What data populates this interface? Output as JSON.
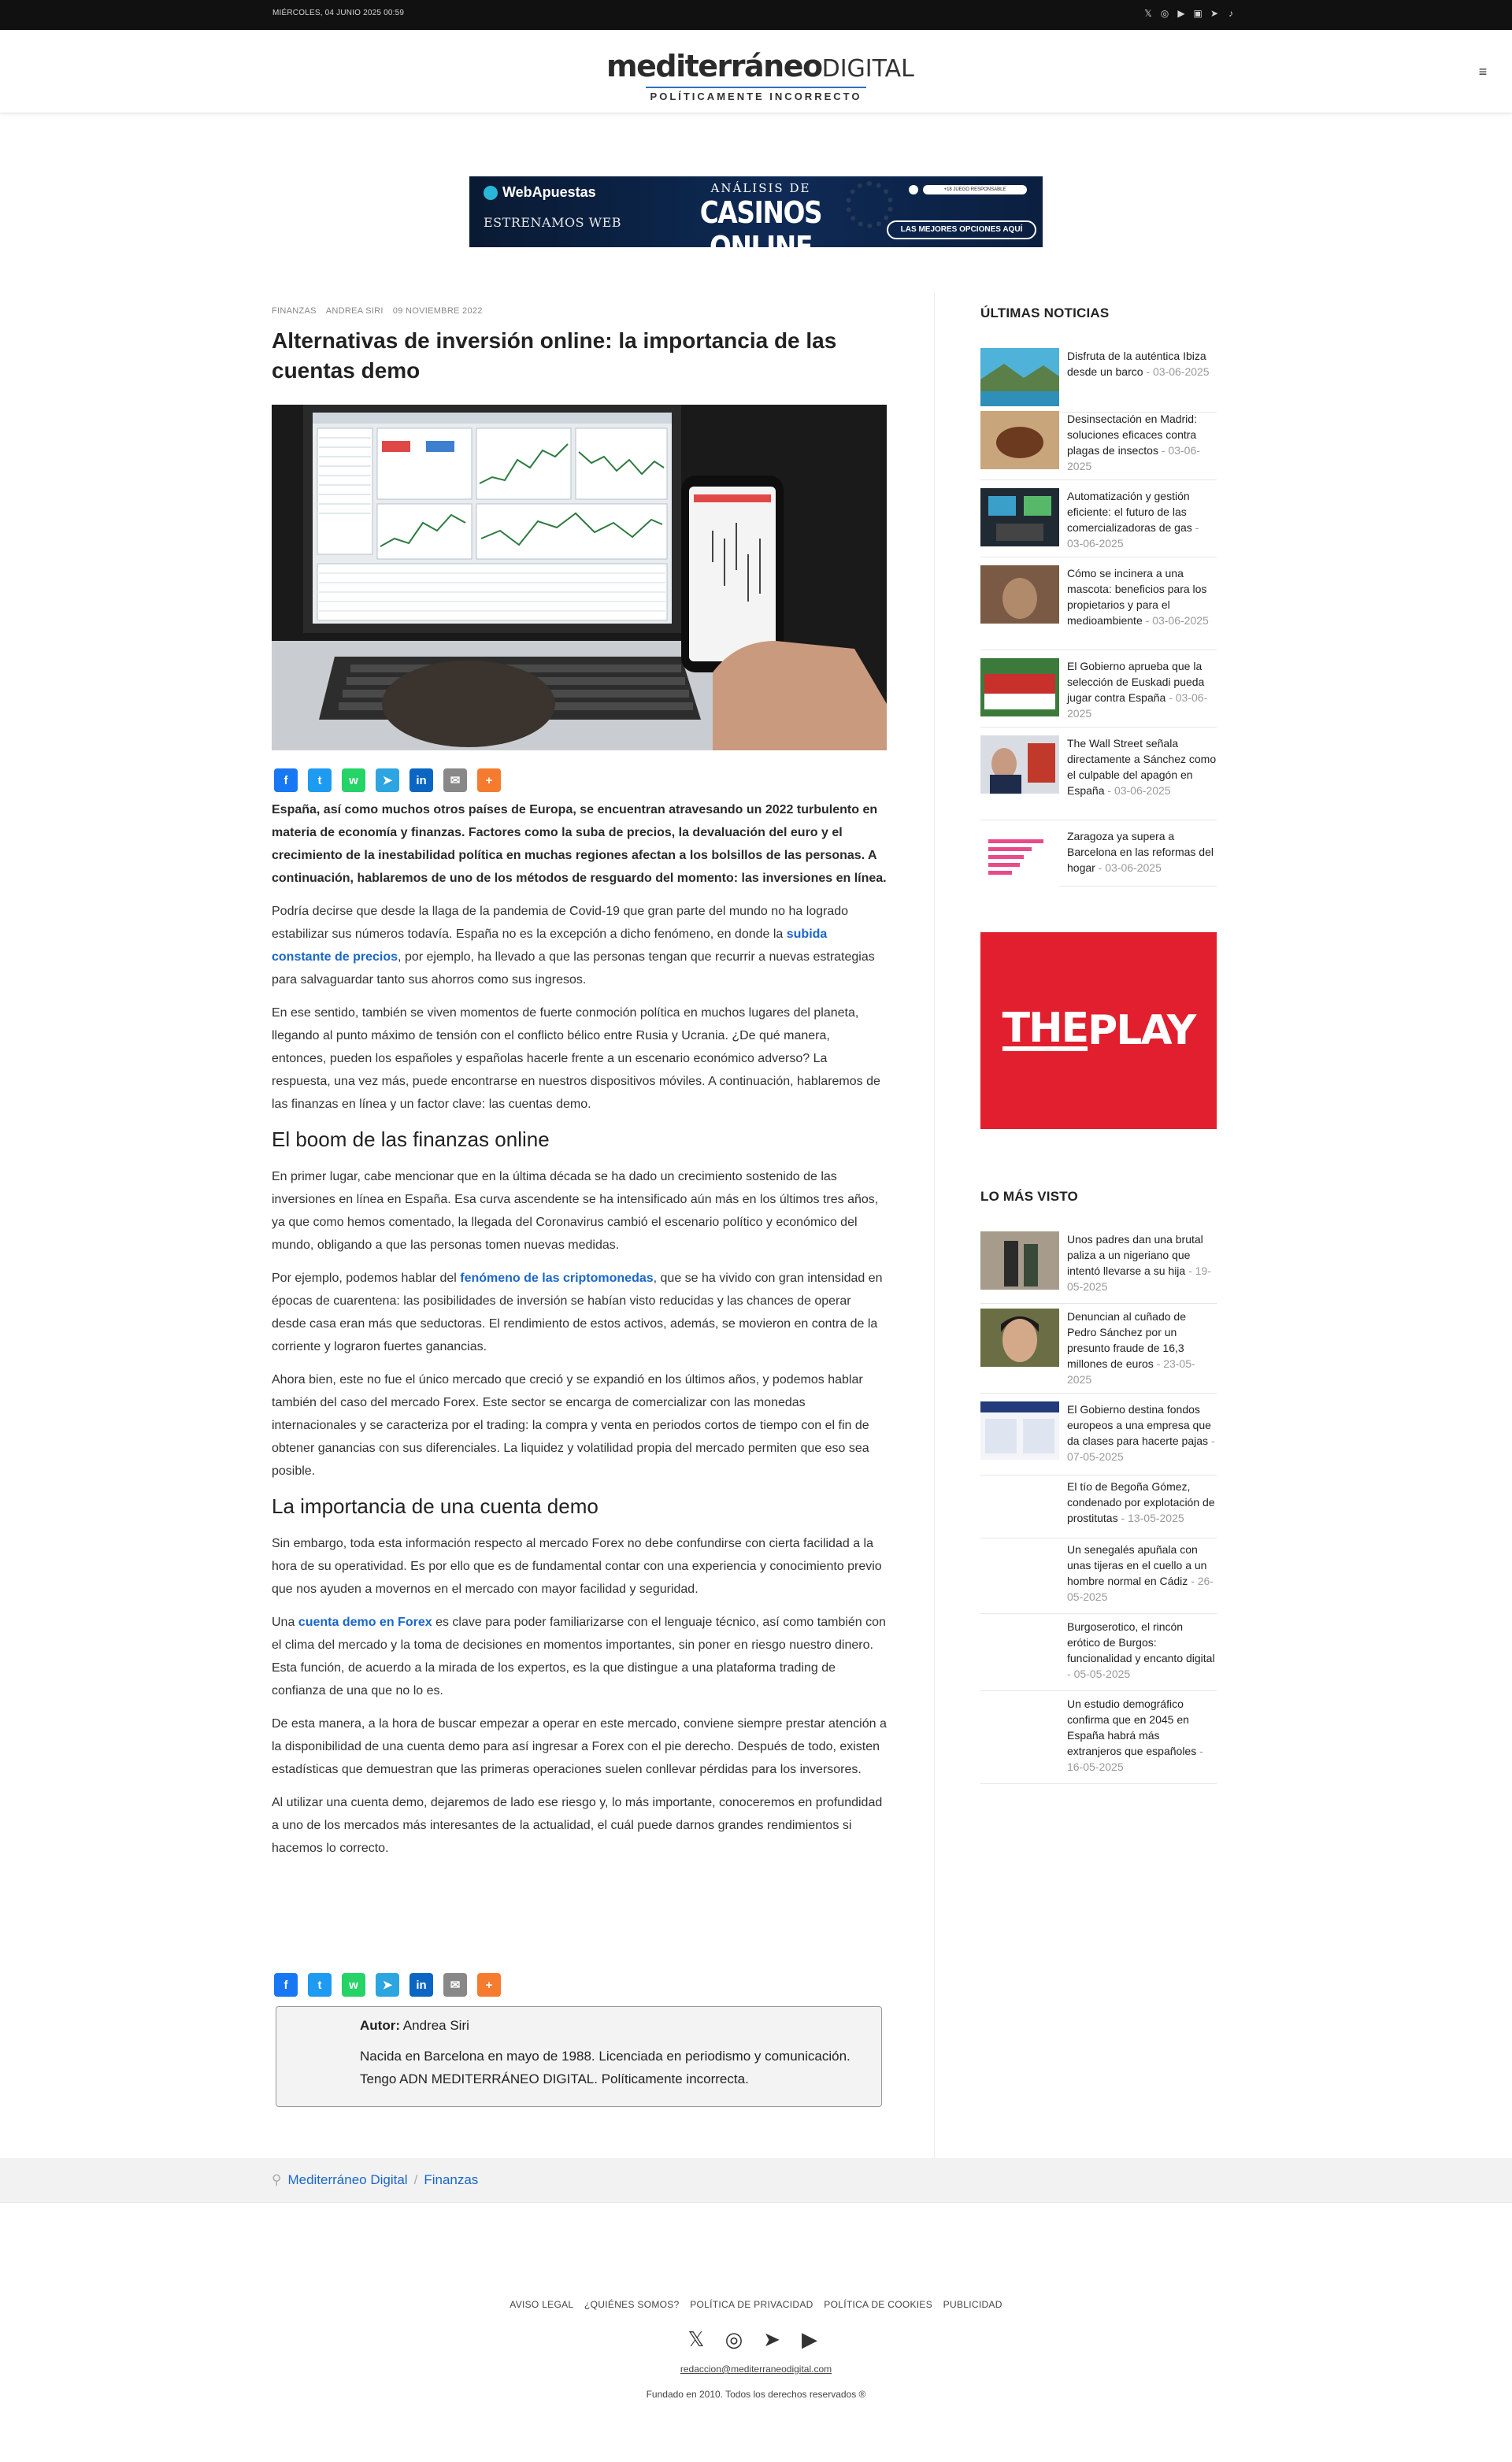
{
  "topbar": {
    "date": "MIÉRCOLES, 04 JUNIO 2025 00:59",
    "social_icons": [
      "twitter-icon",
      "instagram-icon",
      "youtube-icon",
      "flipboard-icon",
      "telegram-icon",
      "tiktok-icon"
    ]
  },
  "header": {
    "brand_main": "mediterráneo",
    "brand_suffix": "DIGITAL",
    "tagline": "POLÍTICAMENTE INCORRECTO",
    "menu_icon": "hamburger-icon"
  },
  "banner": {
    "brand": "WebApuestas",
    "left_text": "ESTRENAMOS WEB",
    "line1": "ANÁLISIS DE",
    "line2": "CASINOS ONLINE",
    "badge": "+18 JUEGO RESPONSABLE",
    "button": "LAS MEJORES OPCIONES AQUÍ"
  },
  "article": {
    "category": "FINANZAS",
    "author": "ANDREA SIRI",
    "date": "09 NOVIEMBRE 2022",
    "title": "Alternativas de inversión online: la importancia de las cuentas demo",
    "lead": "España, así como muchos otros países de Europa, se encuentran atravesando un 2022 turbulento en materia de economía y finanzas. Factores como la suba de precios, la devaluación del euro y el crecimiento de la inestabilidad política en muchas regiones afectan a los bolsillos de las personas. A continuación, hablaremos de uno de los métodos de resguardo del momento: las inversiones en línea.",
    "p1_a": "Podría decirse que desde la llaga de la pandemia de Covid-19 que gran parte del mundo no ha logrado estabilizar sus números todavía. España no es la excepción a dicho fenómeno, en donde la ",
    "p1_link": "subida constante de precios",
    "p1_b": ", por ejemplo, ha llevado a que las personas tengan que recurrir a nuevas estrategias para salvaguardar tanto sus ahorros como sus ingresos.",
    "p2": "En ese sentido, también se viven momentos de fuerte conmoción política en muchos lugares del planeta, llegando al punto máximo de tensión con el conflicto bélico entre Rusia y Ucrania. ¿De qué manera, entonces, pueden los españoles y españolas hacerle frente a un escenario económico adverso? La respuesta, una vez más, puede encontrarse en nuestros dispositivos móviles. A continuación, hablaremos de las finanzas en línea y un factor clave: las cuentas demo.",
    "h2_1": "El boom de las finanzas online",
    "p3": "En primer lugar, cabe mencionar que en la última década se ha dado un crecimiento sostenido de las inversiones en línea en España. Esa curva ascendente se ha intensificado aún más en los últimos tres años, ya que como hemos comentado, la llegada del Coronavirus cambió el escenario político y económico del mundo, obligando a que las personas tomen nuevas medidas.",
    "p4_a": "Por ejemplo, podemos hablar del ",
    "p4_link": "fenómeno de las criptomonedas",
    "p4_b": ", que se ha vivido con gran intensidad en épocas de cuarentena: las posibilidades de inversión se habían visto reducidas y las chances de operar desde casa eran más que seductoras. El rendimiento de estos activos, además, se movieron en contra de la corriente y lograron fuertes ganancias.",
    "p5": "Ahora bien, este no fue el único mercado que creció y se expandió en los últimos años, y podemos hablar también del caso del mercado Forex. Este sector se encarga de comercializar con las monedas internacionales y se caracteriza por el trading: la compra y venta en periodos cortos de tiempo con el fin de obtener ganancias con sus diferenciales. La liquidez y volatilidad propia del mercado permiten que eso sea posible.",
    "h2_2": "La importancia de una cuenta demo",
    "p6": "Sin embargo, toda esta información respecto al mercado Forex no debe confundirse con cierta facilidad a la hora de su operatividad. Es por ello que es de fundamental contar con una experiencia y conocimiento previo que nos ayuden a movernos en el mercado con mayor facilidad y seguridad.",
    "p7_a": "Una ",
    "p7_link": "cuenta demo en Forex",
    "p7_b": " es clave para poder familiarizarse con el lenguaje técnico, así como también con el clima del mercado y la toma de decisiones en momentos importantes, sin poner en riesgo nuestro dinero. Esta función, de acuerdo a la mirada de los expertos, es la que distingue a una plataforma trading de confianza de una que no lo es.",
    "p8": "De esta manera, a la hora de buscar empezar a operar en este mercado, conviene siempre prestar atención a la disponibilidad de una cuenta demo para así ingresar a Forex con el pie derecho. Después de todo, existen estadísticas que demuestran que las primeras operaciones suelen conllevar pérdidas para los inversores.",
    "p9": "Al utilizar una cuenta demo, dejaremos de lado ese riesgo y, lo más importante, conoceremos en profundidad a uno de los mercados más interesantes de la actualidad, el cuál puede darnos grandes rendimientos si hacemos lo correcto.",
    "author_label": "Autor:",
    "author_name": "Andrea Siri",
    "author_bio": "Nacida en Barcelona en mayo de 1988. Licenciada en periodismo y comunicación. Tengo ADN MEDITERRÁNEO DIGITAL. Políticamente incorrecta."
  },
  "share": {
    "buttons": [
      {
        "name": "facebook-share-button",
        "icon": "f",
        "color": "#1877f2"
      },
      {
        "name": "twitter-share-button",
        "icon": "t",
        "color": "#1d9bf0"
      },
      {
        "name": "whatsapp-share-button",
        "icon": "w",
        "color": "#25d366"
      },
      {
        "name": "telegram-share-button",
        "icon": "➤",
        "color": "#2ca5e0"
      },
      {
        "name": "linkedin-share-button",
        "icon": "in",
        "color": "#0a66c2"
      },
      {
        "name": "email-share-button",
        "icon": "✉",
        "color": "#888888"
      },
      {
        "name": "addtoany-share-button",
        "icon": "+",
        "color": "#f57c2e"
      }
    ]
  },
  "sidebar": {
    "latest_title": "ÚLTIMAS NOTICIAS",
    "latest": [
      {
        "title": "Disfruta de la auténtica Ibiza desde un barco",
        "date": "03-06-2025"
      },
      {
        "title": "Desinsectación en Madrid: soluciones eficaces contra plagas de insectos",
        "date": "03-06-2025"
      },
      {
        "title": "Automatización y gestión eficiente: el futuro de las comercializadoras de gas",
        "date": "03-06-2025"
      },
      {
        "title": "Cómo se incinera a una mascota: beneficios para los propietarios y para el medioambiente",
        "date": "03-06-2025"
      },
      {
        "title": "El Gobierno aprueba que la selección de Euskadi pueda jugar contra España",
        "date": "03-06-2025"
      },
      {
        "title": "The Wall Street señala directamente a Sánchez como el culpable del apagón en España",
        "date": "03-06-2025"
      },
      {
        "title": "Zaragoza ya supera a Barcelona en las reformas del hogar",
        "date": "03-06-2025"
      }
    ],
    "ad_text_1": "THE",
    "ad_text_2": "PLAY",
    "most_title": "LO MÁS VISTO",
    "most": [
      {
        "title": "Unos padres dan una brutal paliza a un nigeriano que intentó llevarse a su hija",
        "date": "19-05-2025"
      },
      {
        "title": "Denuncian al cuñado de Pedro Sánchez por un presunto fraude de 16,3 millones de euros",
        "date": "23-05-2025"
      },
      {
        "title": "El Gobierno destina fondos europeos a una empresa que da clases para hacerte pajas",
        "date": "07-05-2025"
      },
      {
        "title": "El tío de Begoña Gómez, condenado por explotación de prostitutas",
        "date": "13-05-2025"
      },
      {
        "title": "Un senegalés apuñala con unas tijeras en el cuello a un hombre normal en Cádiz",
        "date": "26-05-2025"
      },
      {
        "title": "Burgoserotico, el rincón erótico de Burgos: funcionalidad y encanto digital",
        "date": "05-05-2025"
      },
      {
        "title": "Un estudio demográfico confirma que en 2045 en España habrá más extranjeros que españoles",
        "date": "16-05-2025"
      }
    ]
  },
  "breadcrumb": {
    "home": "Mediterráneo Digital",
    "section": "Finanzas",
    "icon": "location-pin-icon"
  },
  "footer": {
    "links": [
      "AVISO LEGAL",
      "¿QUIÉNES SOMOS?",
      "POLÍTICA DE PRIVACIDAD",
      "POLÍTICA DE COOKIES",
      "PUBLICIDAD"
    ],
    "email": "redaccion@mediterraneodigital.com",
    "copyright": "Fundado en 2010. Todos los derechos reservados ®"
  }
}
